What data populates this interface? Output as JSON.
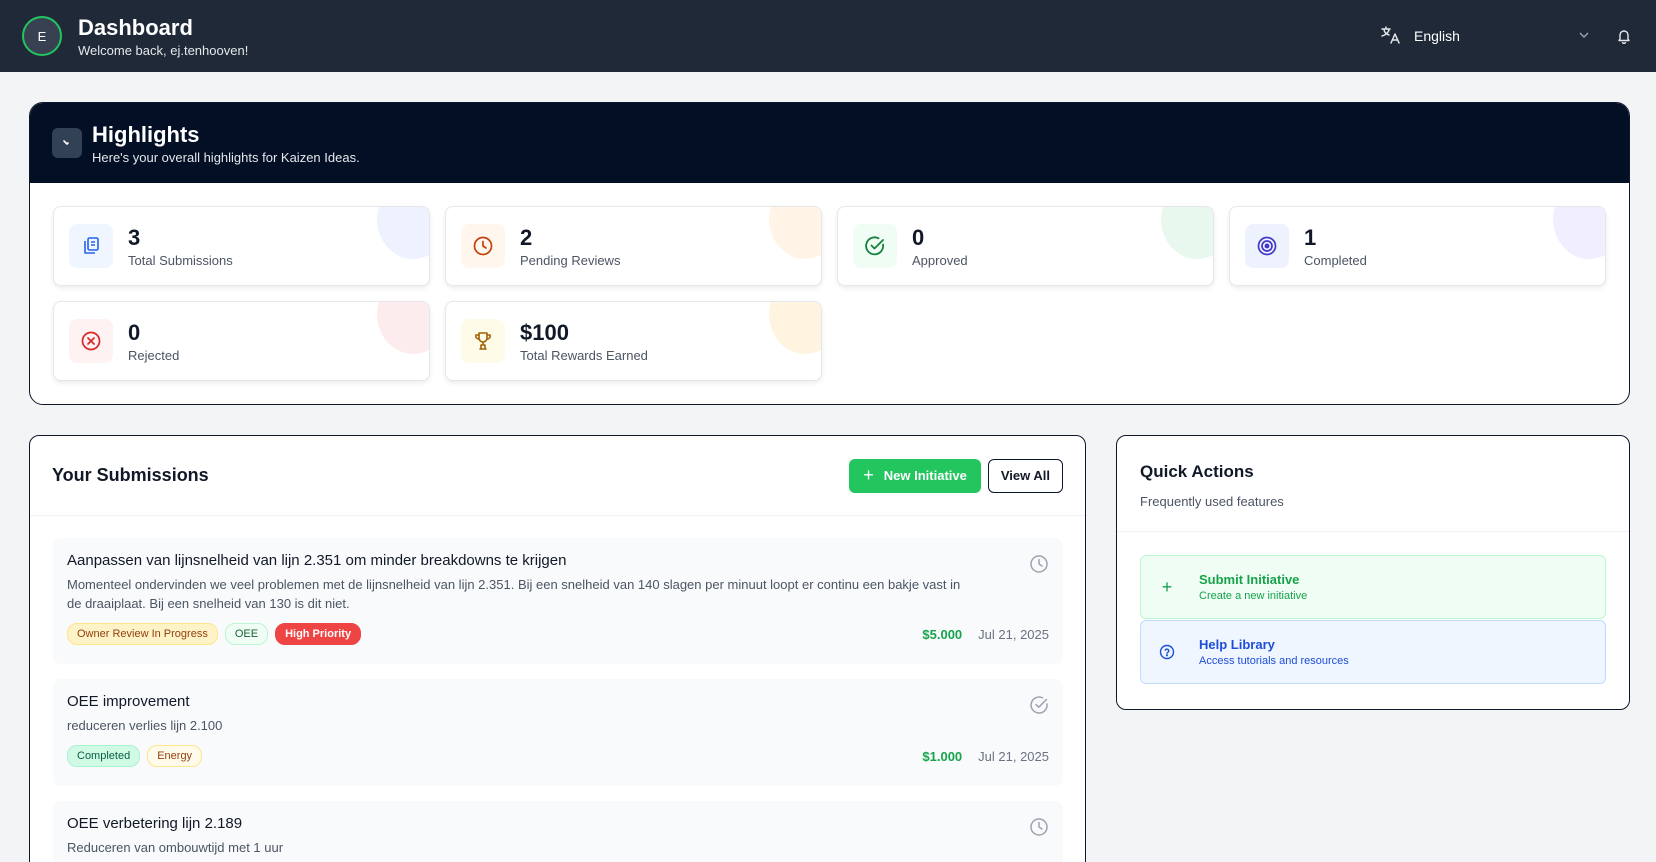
{
  "header": {
    "avatar_initial": "E",
    "title": "Dashboard",
    "welcome": "Welcome back, ej.tenhooven!",
    "language": "English",
    "icons": [
      "translate-icon",
      "chevron-down-icon",
      "bell-icon"
    ]
  },
  "highlights": {
    "title": "Highlights",
    "subtitle": "Here's your overall highlights for Kaizen Ideas.",
    "stats": [
      {
        "value": "3",
        "label": "Total Submissions",
        "icon": "documents-icon",
        "color": "#2563eb"
      },
      {
        "value": "2",
        "label": "Pending Reviews",
        "icon": "clock-icon",
        "color": "#c2410c"
      },
      {
        "value": "0",
        "label": "Approved",
        "icon": "check-circle-icon",
        "color": "#15803d"
      },
      {
        "value": "1",
        "label": "Completed",
        "icon": "target-icon",
        "color": "#4338ca"
      },
      {
        "value": "0",
        "label": "Rejected",
        "icon": "x-circle-icon",
        "color": "#dc2626"
      },
      {
        "value": "$100",
        "label": "Total Rewards Earned",
        "icon": "trophy-icon",
        "color": "#a16207"
      }
    ]
  },
  "submissions": {
    "title": "Your Submissions",
    "new_button": "New Initiative",
    "view_all": "View All",
    "items": [
      {
        "title": "Aanpassen van lijnsnelheid van lijn 2.351 om minder breakdowns te krijgen",
        "description": "Momenteel ondervinden we veel problemen met de lijnsnelheid van lijn 2.351. Bij een snelheid van 140 slagen per minuut loopt er continu een bakje vast in de draaiplaat. Bij een snelheid van 130 is dit niet.",
        "tags": [
          "Owner Review In Progress",
          "OEE",
          "High Priority"
        ],
        "reward": "$5.000",
        "date": "Jul 21, 2025",
        "status_icon": "clock-icon"
      },
      {
        "title": "OEE improvement",
        "description": "reduceren verlies lijn 2.100",
        "tags": [
          "Completed",
          "Energy"
        ],
        "reward": "$1.000",
        "date": "Jul 21, 2025",
        "status_icon": "check-circle-icon"
      },
      {
        "title": "OEE verbetering lijn 2.189",
        "description": "Reduceren van ombouwtijd met 1 uur",
        "status_icon": "clock-icon"
      }
    ]
  },
  "quick_actions": {
    "title": "Quick Actions",
    "subtitle": "Frequently used features",
    "items": [
      {
        "title": "Submit Initiative",
        "subtitle": "Create a new initiative",
        "icon": "plus-icon"
      },
      {
        "title": "Help Library",
        "subtitle": "Access tutorials and resources",
        "icon": "help-circle-icon"
      }
    ]
  }
}
